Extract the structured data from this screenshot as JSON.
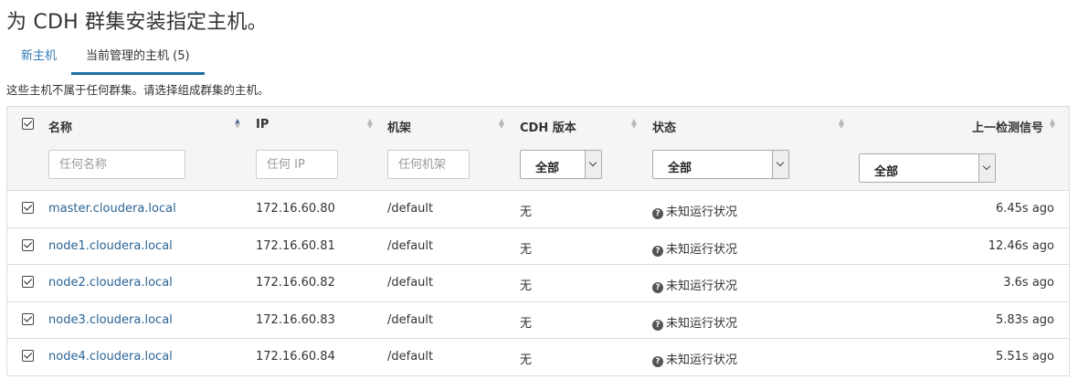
{
  "page": {
    "title": "为 CDH 群集安装指定主机。"
  },
  "tabs": [
    {
      "label": "新主机"
    },
    {
      "label": "当前管理的主机 (5)"
    }
  ],
  "description": "这些主机不属于任何群集。请选择组成群集的主机。",
  "table": {
    "headers": {
      "name": "名称",
      "ip": "IP",
      "rack": "机架",
      "cdh_version": "CDH 版本",
      "status": "状态",
      "last_heartbeat": "上一检测信号"
    },
    "filters": {
      "name_placeholder": "任何名称",
      "ip_placeholder": "任何 IP",
      "rack_placeholder": "任何机架",
      "cdh_version_value": "全部",
      "status_value": "全部",
      "heartbeat_value": "全部"
    },
    "rows": [
      {
        "name": "master.cloudera.local",
        "ip": "172.16.60.80",
        "rack": "/default",
        "cdh_version": "无",
        "status": "未知运行状况",
        "last_heartbeat": "6.45s ago"
      },
      {
        "name": "node1.cloudera.local",
        "ip": "172.16.60.81",
        "rack": "/default",
        "cdh_version": "无",
        "status": "未知运行状况",
        "last_heartbeat": "12.46s ago"
      },
      {
        "name": "node2.cloudera.local",
        "ip": "172.16.60.82",
        "rack": "/default",
        "cdh_version": "无",
        "status": "未知运行状况",
        "last_heartbeat": "3.6s ago"
      },
      {
        "name": "node3.cloudera.local",
        "ip": "172.16.60.83",
        "rack": "/default",
        "cdh_version": "无",
        "status": "未知运行状况",
        "last_heartbeat": "5.83s ago"
      },
      {
        "name": "node4.cloudera.local",
        "ip": "172.16.60.84",
        "rack": "/default",
        "cdh_version": "无",
        "status": "未知运行状况",
        "last_heartbeat": "5.51s ago"
      }
    ]
  },
  "icons": {
    "status_unknown": "question-circle-icon",
    "sort": "sort-icon",
    "checkbox": "checkbox-checked-icon"
  },
  "colors": {
    "link": "#2a6496",
    "tab_underline": "#1f6ea4",
    "header_bg": "#f5f5f5"
  }
}
